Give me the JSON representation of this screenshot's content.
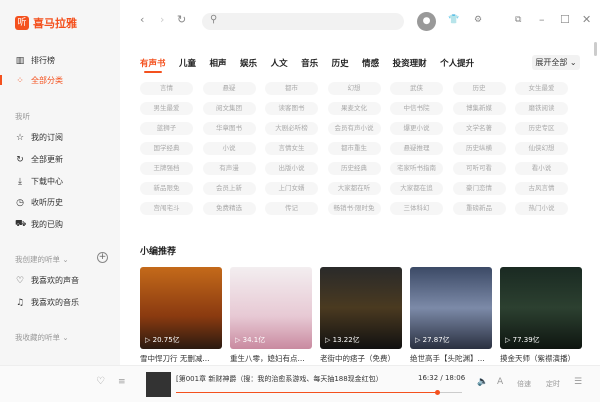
{
  "app": {
    "logo_mark": "听",
    "logo_text": "喜马拉雅"
  },
  "sidebar": {
    "top_items": [
      {
        "label": "排行榜",
        "icon": "chart-icon"
      },
      {
        "label": "全部分类",
        "icon": "grid-icon",
        "active": true
      }
    ],
    "section_listen": "我听",
    "listen_items": [
      {
        "label": "我的订阅",
        "icon": "star-icon"
      },
      {
        "label": "全部更新",
        "icon": "refresh-icon"
      },
      {
        "label": "下载中心",
        "icon": "download-icon"
      },
      {
        "label": "收听历史",
        "icon": "clock-icon"
      },
      {
        "label": "我的已购",
        "icon": "cart-icon"
      }
    ],
    "section_created": "我创建的听单 ⌄",
    "created_items": [
      {
        "label": "我喜欢的声音",
        "icon": "heart-icon"
      },
      {
        "label": "我喜欢的音乐",
        "icon": "music-icon"
      }
    ],
    "section_collected": "我收藏的听单 ⌄"
  },
  "categories": [
    "有声书",
    "儿童",
    "相声",
    "娱乐",
    "人文",
    "音乐",
    "历史",
    "情感",
    "投资理财",
    "个人提升"
  ],
  "expand_label": "展开全部 ⌄",
  "tags": [
    "言情",
    "悬疑",
    "都市",
    "幻想",
    "武侠",
    "历史",
    "女生最爱",
    "男生最爱",
    "阅文集团",
    "读客图书",
    "果麦文化",
    "中信书院",
    "博集新媒",
    "磨铁阅读",
    "蓝狮子",
    "华章图书",
    "大剧必听榜",
    "会员有声小说",
    "爆更小说",
    "文学名著",
    "历史专区",
    "国学经典",
    "小说",
    "言情女生",
    "都市重生",
    "悬疑推理",
    "历史纵横",
    "仙侠幻想",
    "王牌强档",
    "有声漫",
    "出版小说",
    "历史经典",
    "宅家听书指南",
    "可听可看",
    "看小说",
    "新品限免",
    "会员上新",
    "上门女婿",
    "大家都在听",
    "大家都在追",
    "豪门恋情",
    "古风言情",
    "宫闱宅斗",
    "免费精选",
    "传记",
    "畅销书·限时免",
    "三体科幻",
    "重磅新品",
    "热门小说"
  ],
  "recommend": {
    "title": "小编推荐",
    "items": [
      {
        "title": "雪中悍刀行 无删减...",
        "plays": "20.75亿"
      },
      {
        "title": "重生八零，媳妇有点...",
        "plays": "34.1亿"
      },
      {
        "title": "老街中的痞子（免费）",
        "plays": "13.22亿"
      },
      {
        "title": "绝世高手【头陀渊】...",
        "plays": "27.87亿"
      },
      {
        "title": "摸金天师（紫襟演播）",
        "plays": "77.39亿"
      }
    ]
  },
  "player": {
    "title": "[第001章 新财神爵（搜：我的治愈系游戏、每天抽188现金红包）",
    "time": "16:32 / 18:06",
    "progress": 0.913,
    "speed": "倍速",
    "timer": "定时"
  }
}
